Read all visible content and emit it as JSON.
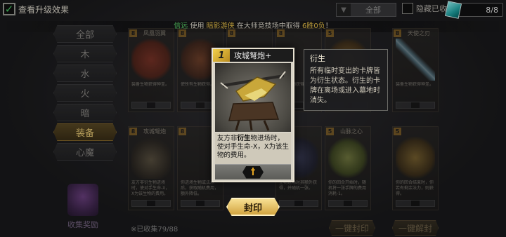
{
  "topbar": {
    "upgrade_check": "✓",
    "upgrade_label": "查看升级效果",
    "filter_value": "全部",
    "hide_label": "隐藏已收",
    "counter": "8/8"
  },
  "ticker": {
    "player": "信远",
    "text1": " 使用 ",
    "deck": "暗影游侠",
    "text2": " 在大师竞技场中取得 ",
    "record": "6胜0负",
    "text3": "！"
  },
  "tabs": [
    {
      "label": "全部",
      "active": false
    },
    {
      "label": "木",
      "active": false
    },
    {
      "label": "水",
      "active": false
    },
    {
      "label": "火",
      "active": false
    },
    {
      "label": "暗",
      "active": false
    },
    {
      "label": "装备",
      "active": true
    },
    {
      "label": "心魔",
      "active": false
    }
  ],
  "collect_reward_label": "收集奖励",
  "collected_text": "※已收集79/88",
  "grid_cards": [
    {
      "cost": "8",
      "title": "凤凰羽翼",
      "desc": "装备生物获得神圣。"
    },
    {
      "cost": "8",
      "title": "",
      "desc": "使所有生物获得。"
    },
    {
      "cost": "8",
      "title": "",
      "desc": ""
    },
    {
      "cost": "8",
      "title": "",
      "desc": "装备生物获得法印。"
    },
    {
      "cost": "5",
      "title": "",
      "desc": ""
    },
    {
      "cost": "8",
      "title": "天使之刃",
      "desc": "装备生物获得神圣。"
    },
    {
      "cost": "8",
      "title": "攻城弩炮",
      "desc": "友方非衍生物进场时，使对手生命-X，X为该生物的费用。"
    },
    {
      "cost": "8",
      "title": "",
      "desc": "你进场生物或法术后，获取随机费用，额外降低。"
    },
    {
      "cost": "8",
      "title": "",
      "desc": "生物进场时其额外获得，并随机一张。"
    },
    {
      "cost": "5",
      "title": "",
      "desc": ""
    },
    {
      "cost": "5",
      "title": "山脉之心",
      "desc": "你的回合开始时，随机将一张手牌的费用消耗-1。"
    },
    {
      "cost": "5",
      "title": "",
      "desc": "你的回合结束时，你若有剩余法力，则获得。"
    }
  ],
  "unlock_buttons": [
    "一键封印",
    "一键解封"
  ],
  "detail": {
    "cost": "1",
    "name": "攻城弩炮+",
    "desc_pre": "友方非",
    "desc_bold": "衍生",
    "desc_post": "物进场时，使对手生命-X，X为该生物的费用。",
    "sigil": "†"
  },
  "tooltip": {
    "title": "衍生",
    "text": "所有临时变出的卡牌皆为衍生状态。衍生的卡牌在离场或进入墓地时消失。"
  },
  "seal_button": "封印",
  "colors": {
    "accent_gold": "#f2cf4b",
    "ticker_green": "#5fe06f",
    "ticker_yellow": "#f1c84b"
  }
}
